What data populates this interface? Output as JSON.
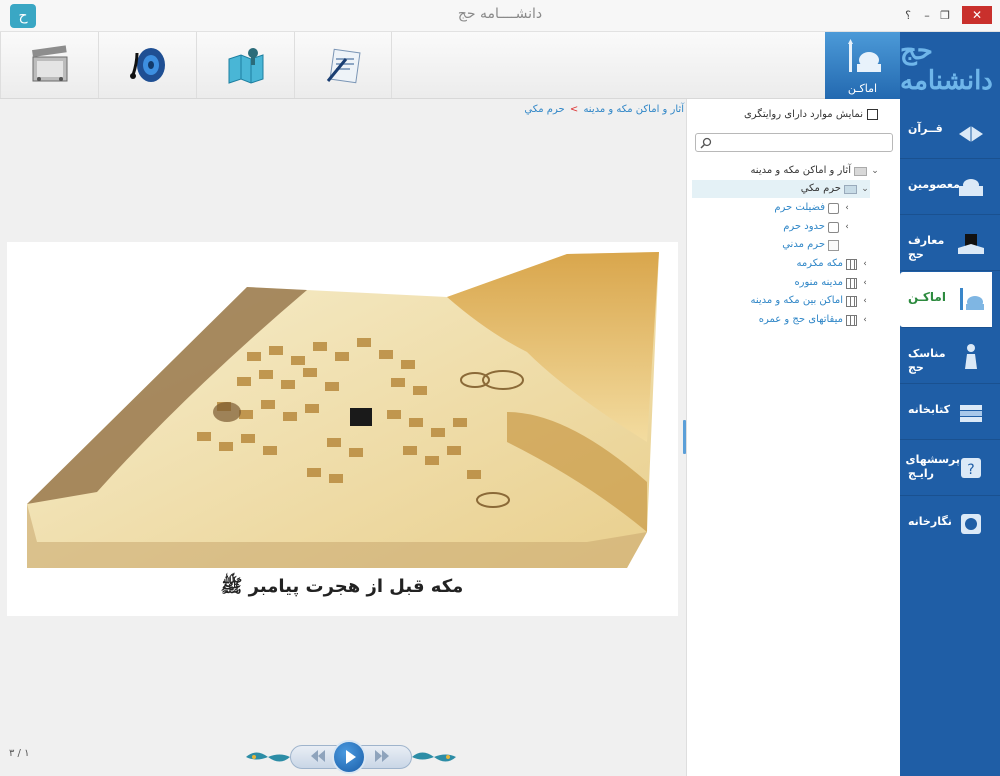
{
  "window": {
    "title": "دانشــــامه حج",
    "app_logo_glyph": "ح",
    "help_label": "؟",
    "restore_glyph": "❐",
    "minimize_glyph": "–",
    "close_glyph": "✕"
  },
  "toolbar": {
    "buttons": [
      {
        "icon": "film-icon"
      },
      {
        "icon": "speaker-icon"
      },
      {
        "icon": "map-icon"
      },
      {
        "icon": "document-pen-icon"
      }
    ],
    "active_tab_label": "اماکـن"
  },
  "sidebar": {
    "logo_text": "حج دانشنامه",
    "items": [
      {
        "label": "قــرآن",
        "icon": "quran-icon"
      },
      {
        "label": "معصومين",
        "icon": "shrine-icon"
      },
      {
        "label": "معارف حج",
        "icon": "kaaba-book-icon"
      },
      {
        "label": "اماکـن",
        "icon": "mosque-icon",
        "active": true
      },
      {
        "label": "مناسک حج",
        "icon": "pilgrim-icon"
      },
      {
        "label": "کتابخانه",
        "icon": "books-icon"
      },
      {
        "label": "پرسشهای رایـج",
        "icon": "question-icon"
      },
      {
        "label": "نگارخانه",
        "icon": "gallery-icon"
      }
    ]
  },
  "tree": {
    "filter_label": "نمایش موارد دارای روایتگری",
    "search_placeholder": "",
    "nodes": [
      {
        "label": "آثار و اماکن مکه و مدينه",
        "chevron": "⌄"
      },
      {
        "label": "حرم مكي",
        "chevron": "⌄"
      },
      {
        "label": "فضيلت حرم",
        "chevron": "›"
      },
      {
        "label": "حدود حرم",
        "chevron": "›"
      },
      {
        "label": "حرم مدني",
        "chevron": ""
      },
      {
        "label": "مكه مكرمه",
        "chevron": "›"
      },
      {
        "label": "مدينه منوره",
        "chevron": "›"
      },
      {
        "label": "اماکن بين مكه و مدينه",
        "chevron": "›"
      },
      {
        "label": "ميقاتهای حج و عمره",
        "chevron": "›"
      }
    ]
  },
  "breadcrumb": {
    "parent": "آثار و اماکن مکه و مدینه",
    "separator": ">",
    "current": "حرم مكي"
  },
  "content": {
    "caption": "مكه قبل از هجرت پيامبر ﷺ",
    "page_counter": "۱ / ۳"
  },
  "colors": {
    "sidebar_bg": "#1f5ea6",
    "accent_blue": "#2f86c7",
    "active_green": "#2c8a3e",
    "close_red": "#c9302c"
  }
}
